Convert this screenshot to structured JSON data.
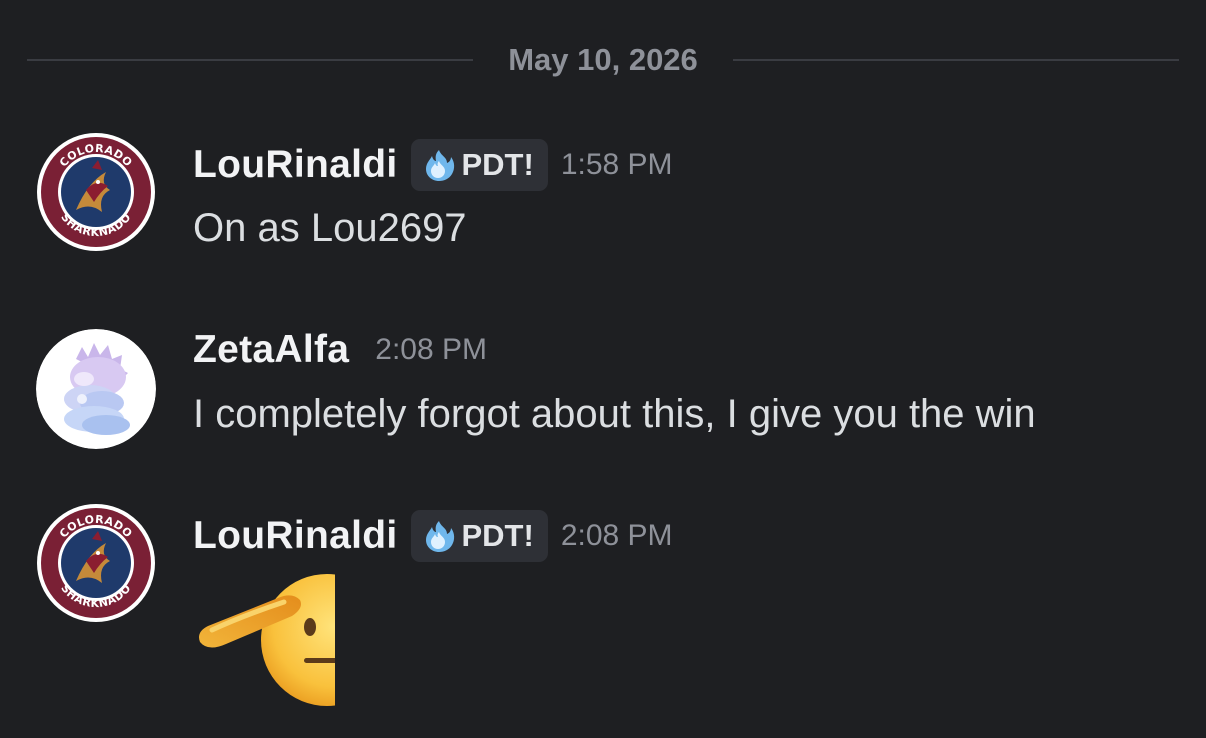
{
  "date_divider": "May 10, 2026",
  "messages": [
    {
      "username": "LouRinaldi",
      "tag": {
        "icon": "blue-flame-icon",
        "label": "PDT!"
      },
      "time": "1:58 PM",
      "text": "On as Lou2697",
      "avatar_text_top": "COLORADO",
      "avatar_text_bottom": "SHARKNADO"
    },
    {
      "username": "ZetaAlfa",
      "time": "2:08 PM",
      "text": "I completely forgot about this, I give you the win"
    },
    {
      "username": "LouRinaldi",
      "tag": {
        "icon": "blue-flame-icon",
        "label": "PDT!"
      },
      "time": "2:08 PM",
      "emoji": "saluting-face-emoji",
      "avatar_text_top": "COLORADO",
      "avatar_text_bottom": "SHARKNADO"
    }
  ],
  "colors": {
    "background": "#1e1f22",
    "username": "#f2f3f5",
    "message_text": "#dbdee1",
    "muted": "#8e9199",
    "tag_background": "#2e3036"
  }
}
